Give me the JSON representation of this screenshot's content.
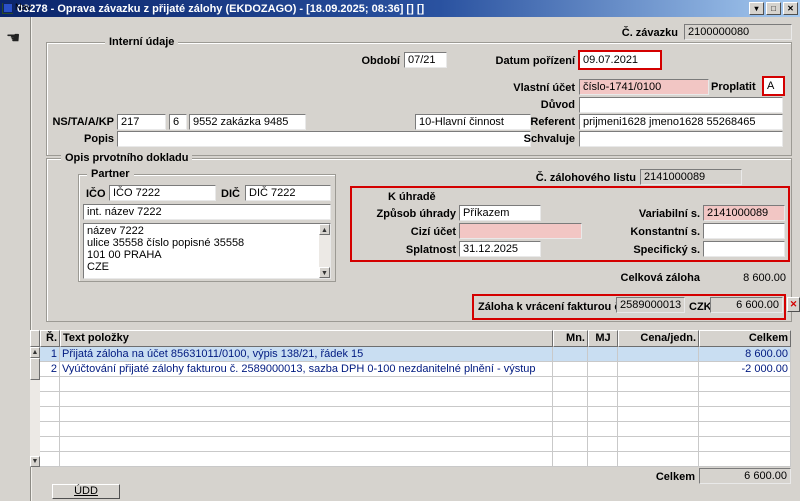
{
  "window": {
    "title": "03278 - Oprava závazku z přijaté zálohy (EKDOZAGO) - [18.09.2025; 08:36]  []  []"
  },
  "icons": {
    "minimize": "▾",
    "maximize": "□",
    "close": "✕",
    "scroll_up": "▲",
    "scroll_down": "▼",
    "hand": "☚",
    "remove_x": "✕"
  },
  "sidebar": {
    "nav_label": "Nav"
  },
  "header": {
    "c_zavazku": {
      "label": "Č. závazku",
      "value": "2100000080"
    }
  },
  "internal": {
    "title": "Interní údaje",
    "obdobi": {
      "label": "Období",
      "value": "07/21"
    },
    "datum_porizeni": {
      "label": "Datum pořízení",
      "value": "09.07.2021"
    },
    "vlastni_ucet": {
      "label": "Vlastní účet",
      "value": "číslo-1741/0100"
    },
    "proplatit": {
      "label": "Proplatit",
      "value": "A"
    },
    "duvod": {
      "label": "Důvod",
      "value": ""
    },
    "ns_ta_a_kp": {
      "label": "NS/TA/A/KP",
      "ns": "217",
      "ta": "6",
      "a": "9552 zakázka 9485",
      "kp": "10-Hlavní činnost"
    },
    "referent": {
      "label": "Referent",
      "value": "prijmeni1628 jmeno1628 55268465"
    },
    "popis": {
      "label": "Popis",
      "value": ""
    },
    "schvaluje": {
      "label": "Schvaluje",
      "value": ""
    }
  },
  "opis": {
    "title": "Opis prvotního dokladu",
    "partner": {
      "title": "Partner",
      "ico_label": "IČO",
      "ico_value": "IČO 7222",
      "dic_label": "DIČ",
      "dic_value": "DIČ 7222",
      "int_nazev": "int. název 7222",
      "address_lines": [
        "název 7222",
        "ulice 35558 číslo popisné 35558",
        "101 00 PRAHA",
        "CZE"
      ]
    },
    "c_zalohoveho_listu": {
      "label": "Č. zálohového listu",
      "value": "2141000089"
    },
    "k_uhrade": {
      "title": "K úhradě",
      "zpusob_uhrady": {
        "label": "Způsob úhrady",
        "value": "Příkazem"
      },
      "cizi_ucet": {
        "label": "Cizí účet",
        "value": ""
      },
      "splatnost": {
        "label": "Splatnost",
        "value": "31.12.2025"
      },
      "variabilni_s": {
        "label": "Variabilní s.",
        "value": "2141000089"
      },
      "konstantni_s": {
        "label": "Konstantní s.",
        "value": ""
      },
      "specificky_s": {
        "label": "Specifický s.",
        "value": ""
      }
    },
    "celkova_zaloha": {
      "label": "Celková záloha",
      "value": "8 600.00"
    },
    "zaloha_k_vraceni": {
      "label": "Záloha k vrácení fakturou č.",
      "value": "2589000013",
      "currency_label": "CZK",
      "amount": "6 600.00"
    }
  },
  "table": {
    "headers": {
      "r": "Ř.",
      "text": "Text položky",
      "mn": "Mn.",
      "mj": "MJ",
      "cena": "Cena/jedn.",
      "celkem": "Celkem"
    },
    "rows": [
      {
        "r": "1",
        "text": "Přijatá záloha na účet 85631011/0100, výpis 138/21, řádek 15",
        "mn": "",
        "mj": "",
        "cena": "",
        "celkem": "8 600.00"
      },
      {
        "r": "2",
        "text": "Vyúčtování přijaté zálohy fakturou č. 2589000013, sazba DPH 0-100 nezdanitelné plnění - výstup",
        "mn": "",
        "mj": "",
        "cena": "",
        "celkem": "-2 000.00"
      }
    ]
  },
  "footer": {
    "celkem_label": "Celkem",
    "celkem_value": "6 600.00",
    "udd_button": "ÚDD"
  }
}
